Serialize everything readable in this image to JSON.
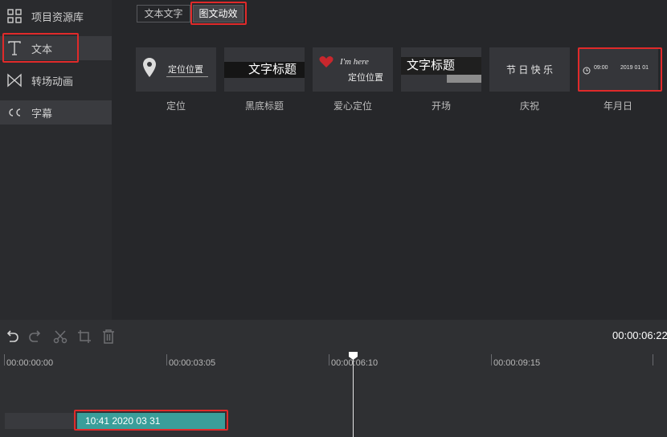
{
  "sidebar": {
    "items": [
      {
        "label": "项目资源库",
        "icon": "grid-icon"
      },
      {
        "label": "文本",
        "icon": "text-t-icon"
      },
      {
        "label": "转场动画",
        "icon": "bowtie-transition-icon"
      },
      {
        "label": "字幕",
        "icon": "cc-subtitle-icon"
      }
    ]
  },
  "tabs": [
    {
      "label": "文本文字"
    },
    {
      "label": "图文动效"
    }
  ],
  "tiles": [
    {
      "label": "定位",
      "preview_text": "定位位置"
    },
    {
      "label": "黑底标题",
      "preview_text": "文字标题"
    },
    {
      "label": "爱心定位",
      "preview_text": "I'm here",
      "preview_text2": "定位位置"
    },
    {
      "label": "开场",
      "preview_text": "文字标题"
    },
    {
      "label": "庆祝",
      "preview_text": "节 日 快 乐"
    },
    {
      "label": "年月日",
      "preview_time": "09:00",
      "preview_date": "2019 01 01"
    }
  ],
  "toolbar": {
    "timecode": "00:00:06:22"
  },
  "ruler": {
    "labels": [
      "00:00:00:00",
      "00:00:03:05",
      "00:00:06:10",
      "00:00:09:15"
    ]
  },
  "clip": {
    "label": "10:41   2020 03 31"
  },
  "colors": {
    "highlight": "#e02a2a",
    "clip": "#3a9e9a",
    "background": "#242528"
  }
}
